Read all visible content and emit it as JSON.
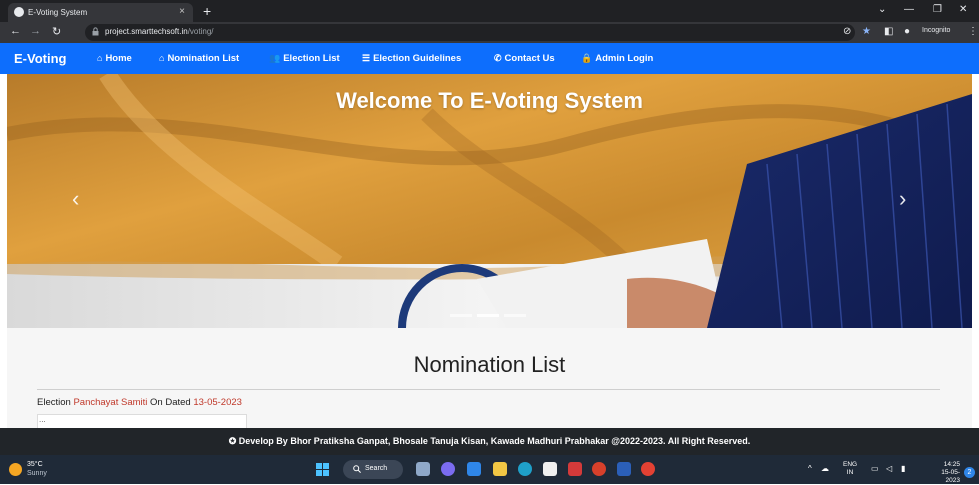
{
  "browser": {
    "tab_title": "E-Voting System",
    "tab_close": "×",
    "new_tab": "+",
    "url_host": "project.smarttechsoft.in",
    "url_path": "/voting/",
    "incognito_label": "Incognito",
    "window_controls": [
      "⌄",
      "—",
      "❐",
      "✕"
    ]
  },
  "navbar": {
    "brand": "E-Voting",
    "links": [
      {
        "icon": "home-icon",
        "glyph": "⌂",
        "label": "Home"
      },
      {
        "icon": "home-icon",
        "glyph": "⌂",
        "label": "Nomination List"
      },
      {
        "icon": "users-icon",
        "glyph": "👥",
        "label": "Election List"
      },
      {
        "icon": "list-icon",
        "glyph": "☰",
        "label": "Election Guidelines"
      },
      {
        "icon": "phone-icon",
        "glyph": "✆",
        "label": "Contact Us"
      },
      {
        "icon": "lock-icon",
        "glyph": "🔒",
        "label": "Admin Login"
      }
    ]
  },
  "carousel": {
    "title": "Welcome To E-Voting System",
    "prev": "‹",
    "next": "›"
  },
  "main": {
    "section_title": "Nomination List",
    "election_prefix": "Election",
    "election_name": "Panchayat Samiti",
    "on_dated": "On Dated",
    "date": "13-05-2023",
    "broken_image_alt": "..."
  },
  "footer": {
    "text": "Develop By Bhor Pratiksha Ganpat, Bhosale Tanuja Kisan, Kawade Madhuri Prabhakar @2022-2023. All Right Reserved."
  },
  "taskbar": {
    "weather_temp": "35°C",
    "weather_desc": "Sunny",
    "search_label": "Search",
    "lang_top": "ENG",
    "lang_bottom": "IN",
    "time": "14:25",
    "date": "15-05-2023",
    "notification_count": "2"
  },
  "colors": {
    "navbar": "#0d6efd",
    "accent_red": "#c0392b",
    "footer": "#212529",
    "taskbar": "#1f2a38"
  }
}
